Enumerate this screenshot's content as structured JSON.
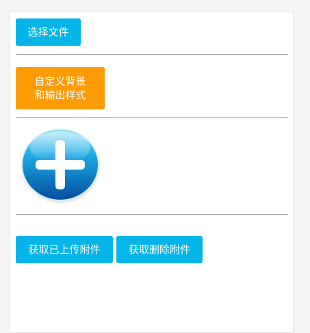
{
  "buttons": {
    "choose_file": "选择文件",
    "custom_style_line1": "自定义背景",
    "custom_style_line2": "和输出样式",
    "get_uploaded": "获取已上传附件",
    "get_deleted": "获取删除附件"
  },
  "icons": {
    "add": "plus-circle-icon"
  },
  "colors": {
    "primary": "#05b4e9",
    "accent": "#ff9b05"
  }
}
